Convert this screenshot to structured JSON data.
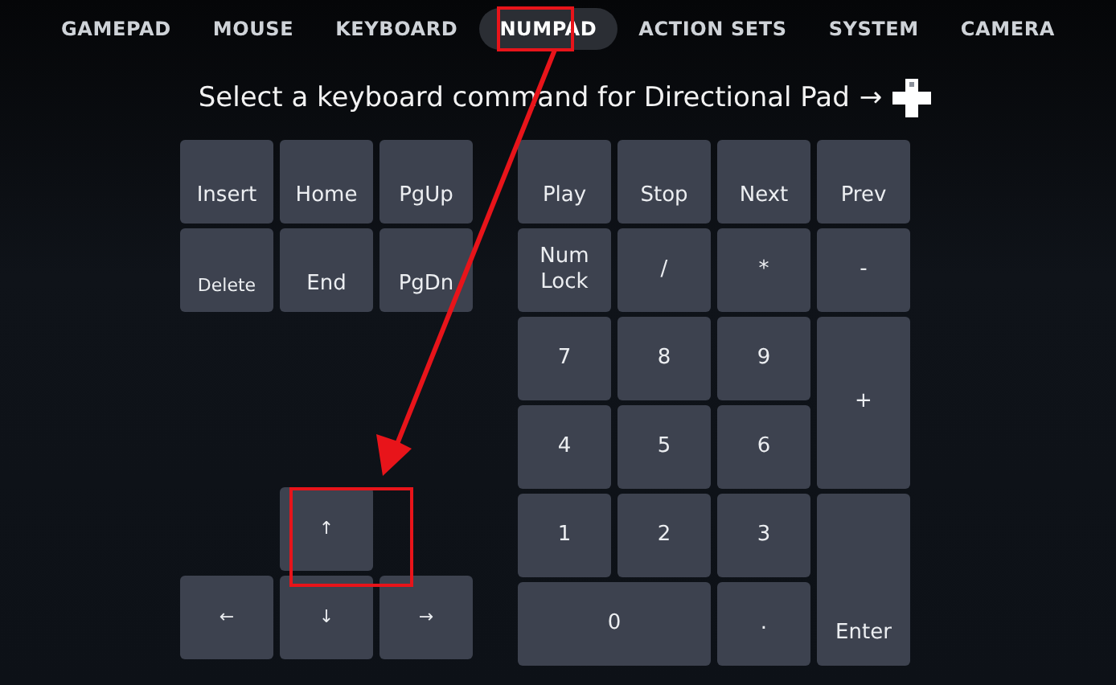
{
  "tabs": [
    {
      "label": "GAMEPAD",
      "selected": false
    },
    {
      "label": "MOUSE",
      "selected": false
    },
    {
      "label": "KEYBOARD",
      "selected": false
    },
    {
      "label": "NUMPAD",
      "selected": true
    },
    {
      "label": "ACTION SETS",
      "selected": false
    },
    {
      "label": "SYSTEM",
      "selected": false
    },
    {
      "label": "CAMERA",
      "selected": false
    }
  ],
  "prompt": {
    "text": "Select a keyboard command for Directional Pad",
    "arrow": "→"
  },
  "navigation_keys": [
    "Insert",
    "Home",
    "PgUp",
    "Delete",
    "End",
    "PgDn"
  ],
  "arrow_keys": {
    "up": "↑",
    "left": "←",
    "down": "↓",
    "right": "→"
  },
  "numpad_keys": [
    {
      "label": "Play",
      "kind": "normal"
    },
    {
      "label": "Stop",
      "kind": "normal"
    },
    {
      "label": "Next",
      "kind": "normal"
    },
    {
      "label": "Prev",
      "kind": "normal"
    },
    {
      "label": "Num Lock",
      "kind": "normal"
    },
    {
      "label": "/",
      "kind": "normal"
    },
    {
      "label": "*",
      "kind": "normal"
    },
    {
      "label": "-",
      "kind": "normal"
    },
    {
      "label": "7",
      "kind": "normal"
    },
    {
      "label": "8",
      "kind": "normal"
    },
    {
      "label": "9",
      "kind": "normal"
    },
    {
      "label": "+",
      "kind": "tall"
    },
    {
      "label": "4",
      "kind": "normal"
    },
    {
      "label": "5",
      "kind": "normal"
    },
    {
      "label": "6",
      "kind": "normal"
    },
    {
      "label": "1",
      "kind": "normal"
    },
    {
      "label": "2",
      "kind": "normal"
    },
    {
      "label": "3",
      "kind": "normal"
    },
    {
      "label": "Enter",
      "kind": "tall"
    },
    {
      "label": "0",
      "kind": "wide"
    },
    {
      "label": ".",
      "kind": "normal"
    }
  ]
}
